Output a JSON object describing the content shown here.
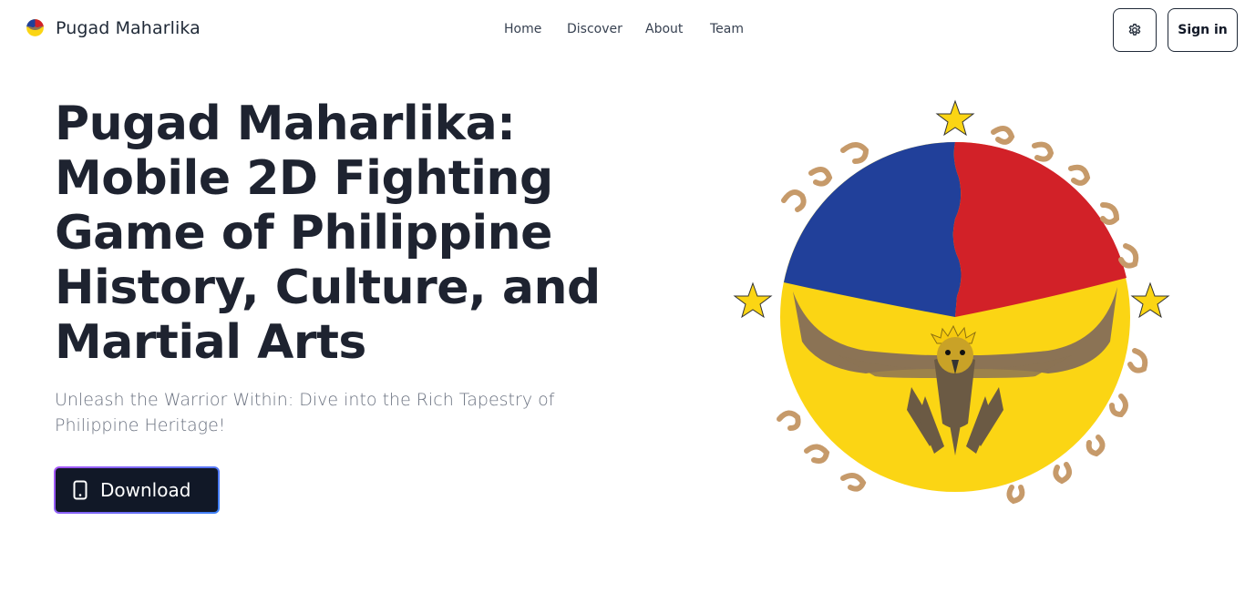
{
  "brand": {
    "name": "Pugad Maharlika",
    "logo_icon": "eagle-emblem-logo"
  },
  "nav": {
    "links": [
      {
        "label": "Home"
      },
      {
        "label": "Discover"
      },
      {
        "label": "About"
      },
      {
        "label": "Team"
      }
    ],
    "theme_icon": "gear-icon",
    "signin_label": "Sign in"
  },
  "hero": {
    "title": "Pugad Maharlika: Mobile 2D Fighting Game of Philippine History, Culture, and Martial Arts",
    "subtitle": "Unleash the Warrior Within: Dive into the Rich Tapestry of Philippine Heritage!",
    "download_label": "Download",
    "download_icon": "phone-icon",
    "art_icon": "philippine-eagle-emblem"
  },
  "colors": {
    "blue": "#21409a",
    "red": "#d22128",
    "yellow": "#fbd514",
    "baybayin": "#c69a6a",
    "dark": "#111827"
  }
}
